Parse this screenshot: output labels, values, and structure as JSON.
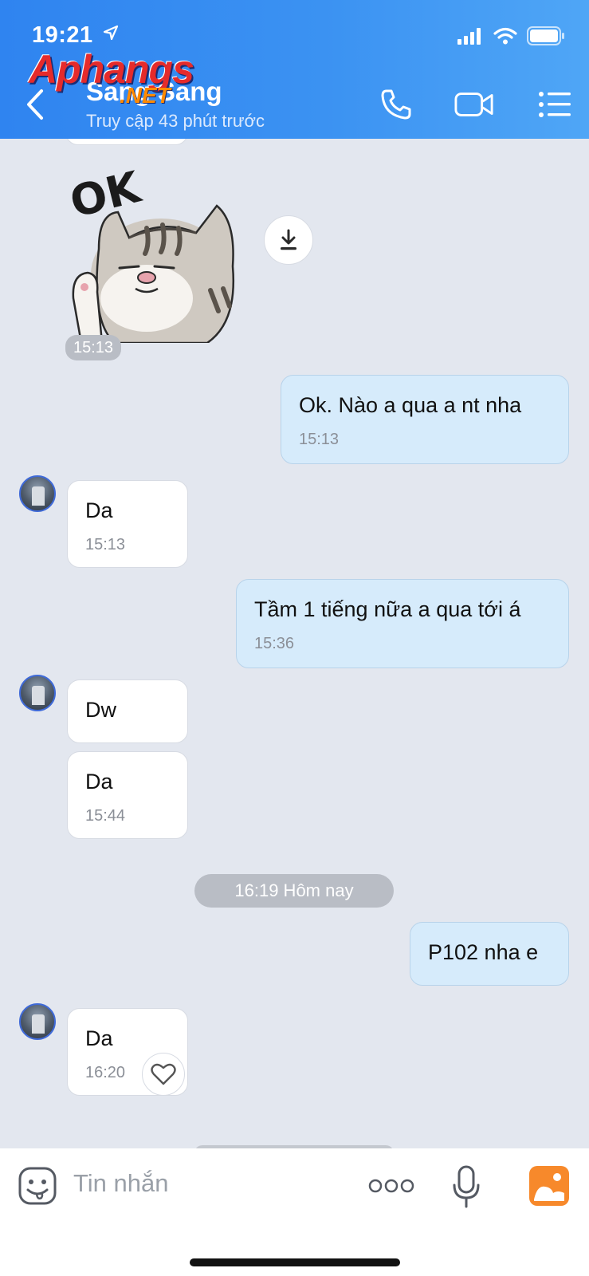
{
  "status_bar": {
    "time": "19:21"
  },
  "watermark": {
    "brand": "Aphangs",
    "suffix": ".NET"
  },
  "header": {
    "contact_name": "Sang Sang",
    "contact_status": "Truy cập 43 phút trước"
  },
  "messages": [
    {
      "kind": "sticker",
      "sender": "them",
      "time": "15:13"
    },
    {
      "kind": "text",
      "sender": "me",
      "text": "Ok. Nào a qua a nt nha",
      "time": "15:13"
    },
    {
      "kind": "text",
      "sender": "them",
      "text": "Da",
      "time": "15:13"
    },
    {
      "kind": "text",
      "sender": "me",
      "text": "Tầm 1 tiếng nữa a qua tới á",
      "time": "15:36"
    },
    {
      "kind": "text",
      "sender": "them",
      "text": "Dw",
      "time": ""
    },
    {
      "kind": "text",
      "sender": "them",
      "text": "Da",
      "time": "15:44"
    },
    {
      "kind": "date",
      "text": "16:19 Hôm nay"
    },
    {
      "kind": "text",
      "sender": "me",
      "text": "P102 nha e",
      "time": ""
    },
    {
      "kind": "text",
      "sender": "them",
      "text": "Da",
      "time": "16:20"
    }
  ],
  "sticker": {
    "text": "OK"
  },
  "composer": {
    "placeholder": "Tin nhắn"
  },
  "colors": {
    "header": "#3b92f2",
    "incoming_bubble": "#ffffff",
    "outgoing_bubble": "#d6ebfb",
    "chat_bg": "#e3e7ef",
    "image_button": "#f7892b"
  }
}
